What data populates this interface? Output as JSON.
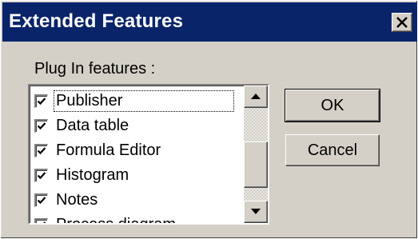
{
  "window": {
    "title": "Extended Features",
    "close_icon": "close-icon"
  },
  "group": {
    "label": "Plug In features :"
  },
  "features": [
    {
      "label": "Publisher",
      "checked": true,
      "focused": true
    },
    {
      "label": "Data table",
      "checked": true
    },
    {
      "label": "Formula Editor",
      "checked": true
    },
    {
      "label": "Histogram",
      "checked": true
    },
    {
      "label": "Notes",
      "checked": true
    },
    {
      "label": "Process diagram",
      "checked": true
    }
  ],
  "buttons": {
    "ok_label": "OK",
    "cancel_label": "Cancel"
  },
  "colors": {
    "titlebar": "#0a246a",
    "face": "#d4d0c8"
  }
}
